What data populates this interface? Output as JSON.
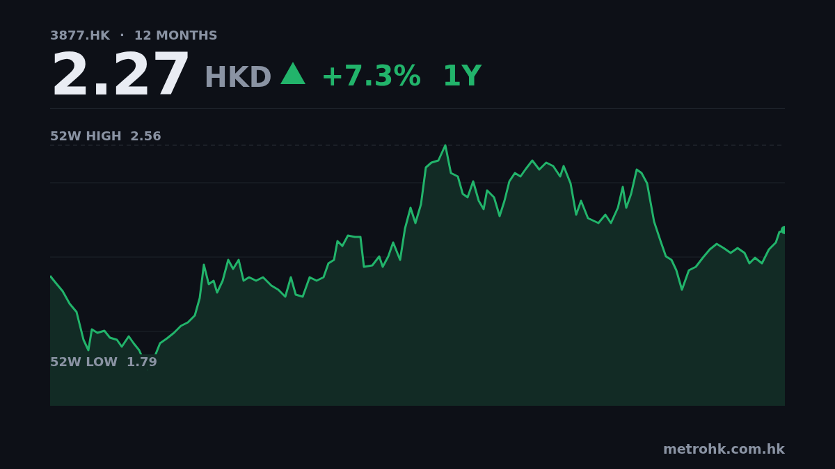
{
  "header": {
    "ticker": "3877.HK",
    "separator": "·",
    "period": "12 MONTHS"
  },
  "quote": {
    "price": "2.27",
    "currency": "HKD",
    "rising": true,
    "change": "+7.3%",
    "range": "1Y"
  },
  "chart": {
    "high_label": "52W HIGH  2.56",
    "low_label": "52W LOW  1.79"
  },
  "footer": {
    "source": "metrohk.com.hk"
  }
}
